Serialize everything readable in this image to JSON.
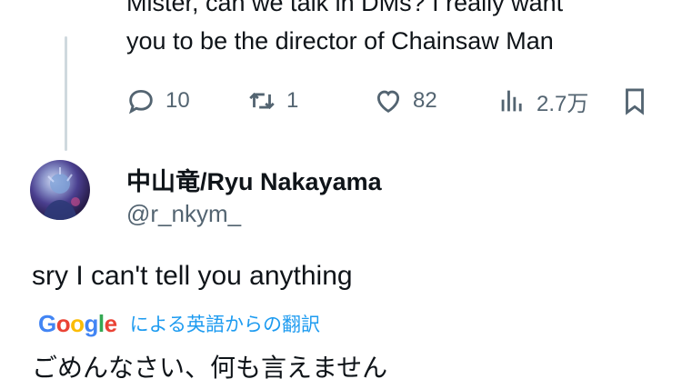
{
  "previous_tweet": {
    "text_line1": "Mister, can we talk in DMs? I really want",
    "text_line2": "you to be the director of Chainsaw Man",
    "actions": {
      "reply_count": "10",
      "retweet_count": "1",
      "like_count": "82",
      "view_count": "2.7万"
    },
    "icons": [
      "reply-icon",
      "retweet-icon",
      "heart-icon",
      "views-icon",
      "bookmark-icon"
    ]
  },
  "reply_tweet": {
    "display_name": "中山竜/Ryu Nakayama",
    "handle": "@r_nkym_",
    "text": "sry I can't tell you anything",
    "translation": {
      "provider_logo": [
        "G",
        "o",
        "o",
        "g",
        "l",
        "e"
      ],
      "label": "による英語からの翻訳",
      "translated_text": "ごめんなさい、何も言えません"
    }
  },
  "colors": {
    "text_primary": "#0f1419",
    "text_secondary": "#536471",
    "link": "#1d9bf0",
    "thread_line": "#cfd9de",
    "google_blue": "#4285f4",
    "google_red": "#ea4335",
    "google_yellow": "#fbbc05",
    "google_green": "#34a853"
  }
}
